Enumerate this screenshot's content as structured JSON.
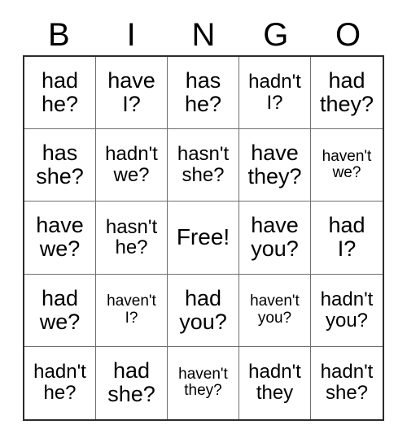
{
  "card": {
    "title": "BINGO",
    "headers": [
      "B",
      "I",
      "N",
      "G",
      "O"
    ],
    "rows": [
      [
        {
          "line1": "had",
          "line2": "he?",
          "size": "lg"
        },
        {
          "line1": "have",
          "line2": "I?",
          "size": "lg"
        },
        {
          "line1": "has",
          "line2": "he?",
          "size": "lg"
        },
        {
          "line1": "hadn't",
          "line2": "I?",
          "size": "md"
        },
        {
          "line1": "had",
          "line2": "they?",
          "size": "lg"
        }
      ],
      [
        {
          "line1": "has",
          "line2": "she?",
          "size": "lg"
        },
        {
          "line1": "hadn't",
          "line2": "we?",
          "size": "md"
        },
        {
          "line1": "hasn't",
          "line2": "she?",
          "size": "md"
        },
        {
          "line1": "have",
          "line2": "they?",
          "size": "lg"
        },
        {
          "line1": "haven't",
          "line2": "we?",
          "size": "sm"
        }
      ],
      [
        {
          "line1": "have",
          "line2": "we?",
          "size": "lg"
        },
        {
          "line1": "hasn't",
          "line2": "he?",
          "size": "md"
        },
        {
          "line1": "Free!",
          "line2": "",
          "size": "free"
        },
        {
          "line1": "have",
          "line2": "you?",
          "size": "lg"
        },
        {
          "line1": "had",
          "line2": "I?",
          "size": "lg"
        }
      ],
      [
        {
          "line1": "had",
          "line2": "we?",
          "size": "lg"
        },
        {
          "line1": "haven't",
          "line2": "I?",
          "size": "sm"
        },
        {
          "line1": "had",
          "line2": "you?",
          "size": "lg"
        },
        {
          "line1": "haven't",
          "line2": "you?",
          "size": "sm"
        },
        {
          "line1": "hadn't",
          "line2": "you?",
          "size": "md"
        }
      ],
      [
        {
          "line1": "hadn't",
          "line2": "he?",
          "size": "md"
        },
        {
          "line1": "had",
          "line2": "she?",
          "size": "lg"
        },
        {
          "line1": "haven't",
          "line2": "they?",
          "size": "sm"
        },
        {
          "line1": "hadn't",
          "line2": "they",
          "size": "md"
        },
        {
          "line1": "hadn't",
          "line2": "she?",
          "size": "md"
        }
      ]
    ]
  },
  "colors": {
    "text": "#000000",
    "background": "#ffffff",
    "outer_border": "#2b2b2b",
    "inner_border": "#6e6e6e"
  }
}
